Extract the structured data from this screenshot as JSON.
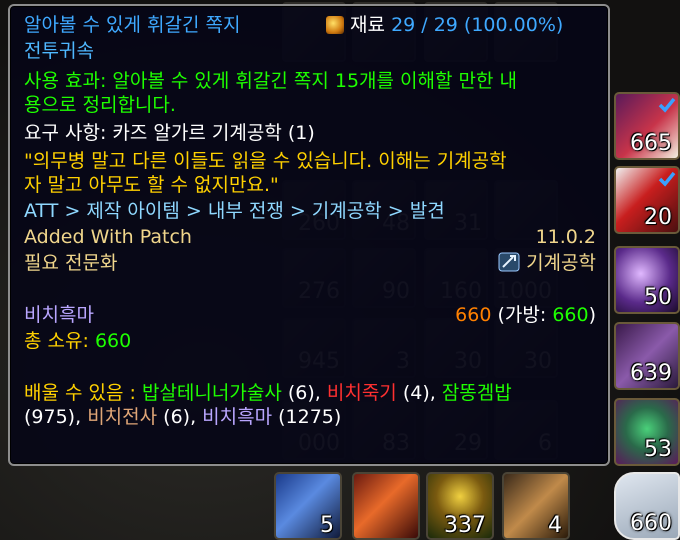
{
  "tooltip": {
    "item_name": "알아볼 수 있게 휘갈긴 쪽지",
    "reagent_label": "재료",
    "reagent_count": "29 / 29 (100.00%)",
    "bind": "전투귀속",
    "use_effect_1": "사용 효과: 알아볼 수 있게 휘갈긴 쪽지 15개를 이해할 만한 내",
    "use_effect_2": "용으로 정리합니다.",
    "requirement": "요구 사항: 카즈 알가르 기계공학 (1)",
    "flavor_1": "\"의무병 말고 다른 이들도 읽을 수 있습니다. 이해는 기계공학",
    "flavor_2": "자 말고 아무도 할 수 없지만요.\"",
    "path": "ATT > 제작 아이템 > 내부 전쟁 > 기계공학 > 발견",
    "added_label": "Added With Patch",
    "patch_version": "11.0.2",
    "profession_label": "필요 전문화",
    "profession_value": "기계공학",
    "character_name": "비치흑마",
    "char_count": "660",
    "char_bank_label": "(가방:",
    "char_bank_value": "660",
    "char_bank_close": ")",
    "total_label": "총 소유:",
    "total_value": "660",
    "learnable_label": "배울 수 있음 :",
    "learnable": [
      {
        "name": "밥살테니너가술사",
        "count": "(6),",
        "color": "#1eff00"
      },
      {
        "name": "비치죽기",
        "count": "(4),",
        "color": "#ff3030"
      },
      {
        "name": "잠똥겜밥",
        "count": "",
        "color": "#1eff00"
      },
      {
        "name": "",
        "count": "(975),",
        "color": "#ffffff"
      },
      {
        "name": "비치전사",
        "count": "(6),",
        "color": "#e0a677"
      },
      {
        "name": "비치흑마",
        "count": "(1275)",
        "color": "#b9a6ff"
      }
    ]
  },
  "background_slots": {
    "counts": [
      "260",
      "48",
      "31",
      "276",
      "90",
      "160",
      "1000",
      "945",
      "3",
      "30",
      "30",
      "000",
      "83",
      "29",
      "6"
    ]
  },
  "side_column": [
    {
      "icon": "tabard-icon",
      "count": "665",
      "checked": true
    },
    {
      "icon": "tabard-icon",
      "count": "20",
      "checked": true
    },
    {
      "icon": "claw-icon",
      "count": "50",
      "checked": false
    },
    {
      "icon": "treasure-chest-icon",
      "count": "639",
      "checked": false
    },
    {
      "icon": "goblin-mask-icon",
      "count": "53",
      "checked": false
    },
    {
      "icon": "scroll-icon",
      "count": "660",
      "checked": false
    }
  ],
  "action_bar": [
    {
      "icon": "gauntlet-icon",
      "count": "5"
    },
    {
      "icon": "card-icon",
      "count": ""
    },
    {
      "icon": "mushroom-icon",
      "count": "337"
    },
    {
      "icon": "bracer-icon",
      "count": "4"
    }
  ],
  "colors": {
    "item_name": "#3fa9ff",
    "use_effect": "#1eff00",
    "flavor": "#ffd100",
    "path": "#8fd8ff",
    "added": "#f0d68c",
    "character": "#b9a6ff",
    "count_highlight": "#ff8000"
  }
}
